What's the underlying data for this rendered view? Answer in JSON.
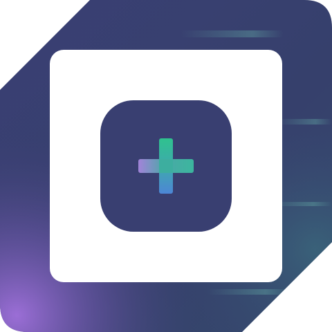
{
  "icon": {
    "name": "plus-app-icon",
    "glyph": "plus-icon",
    "colors": {
      "background_dark": "#3A3F72",
      "background_mid": "#353D6B",
      "glow_purple": "#9B6ED6",
      "glow_teal": "#3E7C86",
      "frame_white": "#FFFFFF",
      "inner_tile": "#393F71",
      "plus_green": "#2FC28E",
      "plus_purple": "#A283D9",
      "plus_blue": "#4D86D6"
    }
  }
}
